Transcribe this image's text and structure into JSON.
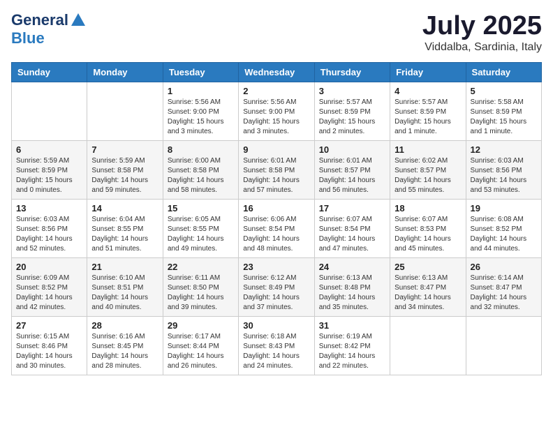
{
  "header": {
    "logo_general": "General",
    "logo_blue": "Blue",
    "month": "July 2025",
    "location": "Viddalba, Sardinia, Italy"
  },
  "weekdays": [
    "Sunday",
    "Monday",
    "Tuesday",
    "Wednesday",
    "Thursday",
    "Friday",
    "Saturday"
  ],
  "weeks": [
    [
      {
        "day": "",
        "sunrise": "",
        "sunset": "",
        "daylight": ""
      },
      {
        "day": "",
        "sunrise": "",
        "sunset": "",
        "daylight": ""
      },
      {
        "day": "1",
        "sunrise": "Sunrise: 5:56 AM",
        "sunset": "Sunset: 9:00 PM",
        "daylight": "Daylight: 15 hours and 3 minutes."
      },
      {
        "day": "2",
        "sunrise": "Sunrise: 5:56 AM",
        "sunset": "Sunset: 9:00 PM",
        "daylight": "Daylight: 15 hours and 3 minutes."
      },
      {
        "day": "3",
        "sunrise": "Sunrise: 5:57 AM",
        "sunset": "Sunset: 8:59 PM",
        "daylight": "Daylight: 15 hours and 2 minutes."
      },
      {
        "day": "4",
        "sunrise": "Sunrise: 5:57 AM",
        "sunset": "Sunset: 8:59 PM",
        "daylight": "Daylight: 15 hours and 1 minute."
      },
      {
        "day": "5",
        "sunrise": "Sunrise: 5:58 AM",
        "sunset": "Sunset: 8:59 PM",
        "daylight": "Daylight: 15 hours and 1 minute."
      }
    ],
    [
      {
        "day": "6",
        "sunrise": "Sunrise: 5:59 AM",
        "sunset": "Sunset: 8:59 PM",
        "daylight": "Daylight: 15 hours and 0 minutes."
      },
      {
        "day": "7",
        "sunrise": "Sunrise: 5:59 AM",
        "sunset": "Sunset: 8:58 PM",
        "daylight": "Daylight: 14 hours and 59 minutes."
      },
      {
        "day": "8",
        "sunrise": "Sunrise: 6:00 AM",
        "sunset": "Sunset: 8:58 PM",
        "daylight": "Daylight: 14 hours and 58 minutes."
      },
      {
        "day": "9",
        "sunrise": "Sunrise: 6:01 AM",
        "sunset": "Sunset: 8:58 PM",
        "daylight": "Daylight: 14 hours and 57 minutes."
      },
      {
        "day": "10",
        "sunrise": "Sunrise: 6:01 AM",
        "sunset": "Sunset: 8:57 PM",
        "daylight": "Daylight: 14 hours and 56 minutes."
      },
      {
        "day": "11",
        "sunrise": "Sunrise: 6:02 AM",
        "sunset": "Sunset: 8:57 PM",
        "daylight": "Daylight: 14 hours and 55 minutes."
      },
      {
        "day": "12",
        "sunrise": "Sunrise: 6:03 AM",
        "sunset": "Sunset: 8:56 PM",
        "daylight": "Daylight: 14 hours and 53 minutes."
      }
    ],
    [
      {
        "day": "13",
        "sunrise": "Sunrise: 6:03 AM",
        "sunset": "Sunset: 8:56 PM",
        "daylight": "Daylight: 14 hours and 52 minutes."
      },
      {
        "day": "14",
        "sunrise": "Sunrise: 6:04 AM",
        "sunset": "Sunset: 8:55 PM",
        "daylight": "Daylight: 14 hours and 51 minutes."
      },
      {
        "day": "15",
        "sunrise": "Sunrise: 6:05 AM",
        "sunset": "Sunset: 8:55 PM",
        "daylight": "Daylight: 14 hours and 49 minutes."
      },
      {
        "day": "16",
        "sunrise": "Sunrise: 6:06 AM",
        "sunset": "Sunset: 8:54 PM",
        "daylight": "Daylight: 14 hours and 48 minutes."
      },
      {
        "day": "17",
        "sunrise": "Sunrise: 6:07 AM",
        "sunset": "Sunset: 8:54 PM",
        "daylight": "Daylight: 14 hours and 47 minutes."
      },
      {
        "day": "18",
        "sunrise": "Sunrise: 6:07 AM",
        "sunset": "Sunset: 8:53 PM",
        "daylight": "Daylight: 14 hours and 45 minutes."
      },
      {
        "day": "19",
        "sunrise": "Sunrise: 6:08 AM",
        "sunset": "Sunset: 8:52 PM",
        "daylight": "Daylight: 14 hours and 44 minutes."
      }
    ],
    [
      {
        "day": "20",
        "sunrise": "Sunrise: 6:09 AM",
        "sunset": "Sunset: 8:52 PM",
        "daylight": "Daylight: 14 hours and 42 minutes."
      },
      {
        "day": "21",
        "sunrise": "Sunrise: 6:10 AM",
        "sunset": "Sunset: 8:51 PM",
        "daylight": "Daylight: 14 hours and 40 minutes."
      },
      {
        "day": "22",
        "sunrise": "Sunrise: 6:11 AM",
        "sunset": "Sunset: 8:50 PM",
        "daylight": "Daylight: 14 hours and 39 minutes."
      },
      {
        "day": "23",
        "sunrise": "Sunrise: 6:12 AM",
        "sunset": "Sunset: 8:49 PM",
        "daylight": "Daylight: 14 hours and 37 minutes."
      },
      {
        "day": "24",
        "sunrise": "Sunrise: 6:13 AM",
        "sunset": "Sunset: 8:48 PM",
        "daylight": "Daylight: 14 hours and 35 minutes."
      },
      {
        "day": "25",
        "sunrise": "Sunrise: 6:13 AM",
        "sunset": "Sunset: 8:47 PM",
        "daylight": "Daylight: 14 hours and 34 minutes."
      },
      {
        "day": "26",
        "sunrise": "Sunrise: 6:14 AM",
        "sunset": "Sunset: 8:47 PM",
        "daylight": "Daylight: 14 hours and 32 minutes."
      }
    ],
    [
      {
        "day": "27",
        "sunrise": "Sunrise: 6:15 AM",
        "sunset": "Sunset: 8:46 PM",
        "daylight": "Daylight: 14 hours and 30 minutes."
      },
      {
        "day": "28",
        "sunrise": "Sunrise: 6:16 AM",
        "sunset": "Sunset: 8:45 PM",
        "daylight": "Daylight: 14 hours and 28 minutes."
      },
      {
        "day": "29",
        "sunrise": "Sunrise: 6:17 AM",
        "sunset": "Sunset: 8:44 PM",
        "daylight": "Daylight: 14 hours and 26 minutes."
      },
      {
        "day": "30",
        "sunrise": "Sunrise: 6:18 AM",
        "sunset": "Sunset: 8:43 PM",
        "daylight": "Daylight: 14 hours and 24 minutes."
      },
      {
        "day": "31",
        "sunrise": "Sunrise: 6:19 AM",
        "sunset": "Sunset: 8:42 PM",
        "daylight": "Daylight: 14 hours and 22 minutes."
      },
      {
        "day": "",
        "sunrise": "",
        "sunset": "",
        "daylight": ""
      },
      {
        "day": "",
        "sunrise": "",
        "sunset": "",
        "daylight": ""
      }
    ]
  ]
}
